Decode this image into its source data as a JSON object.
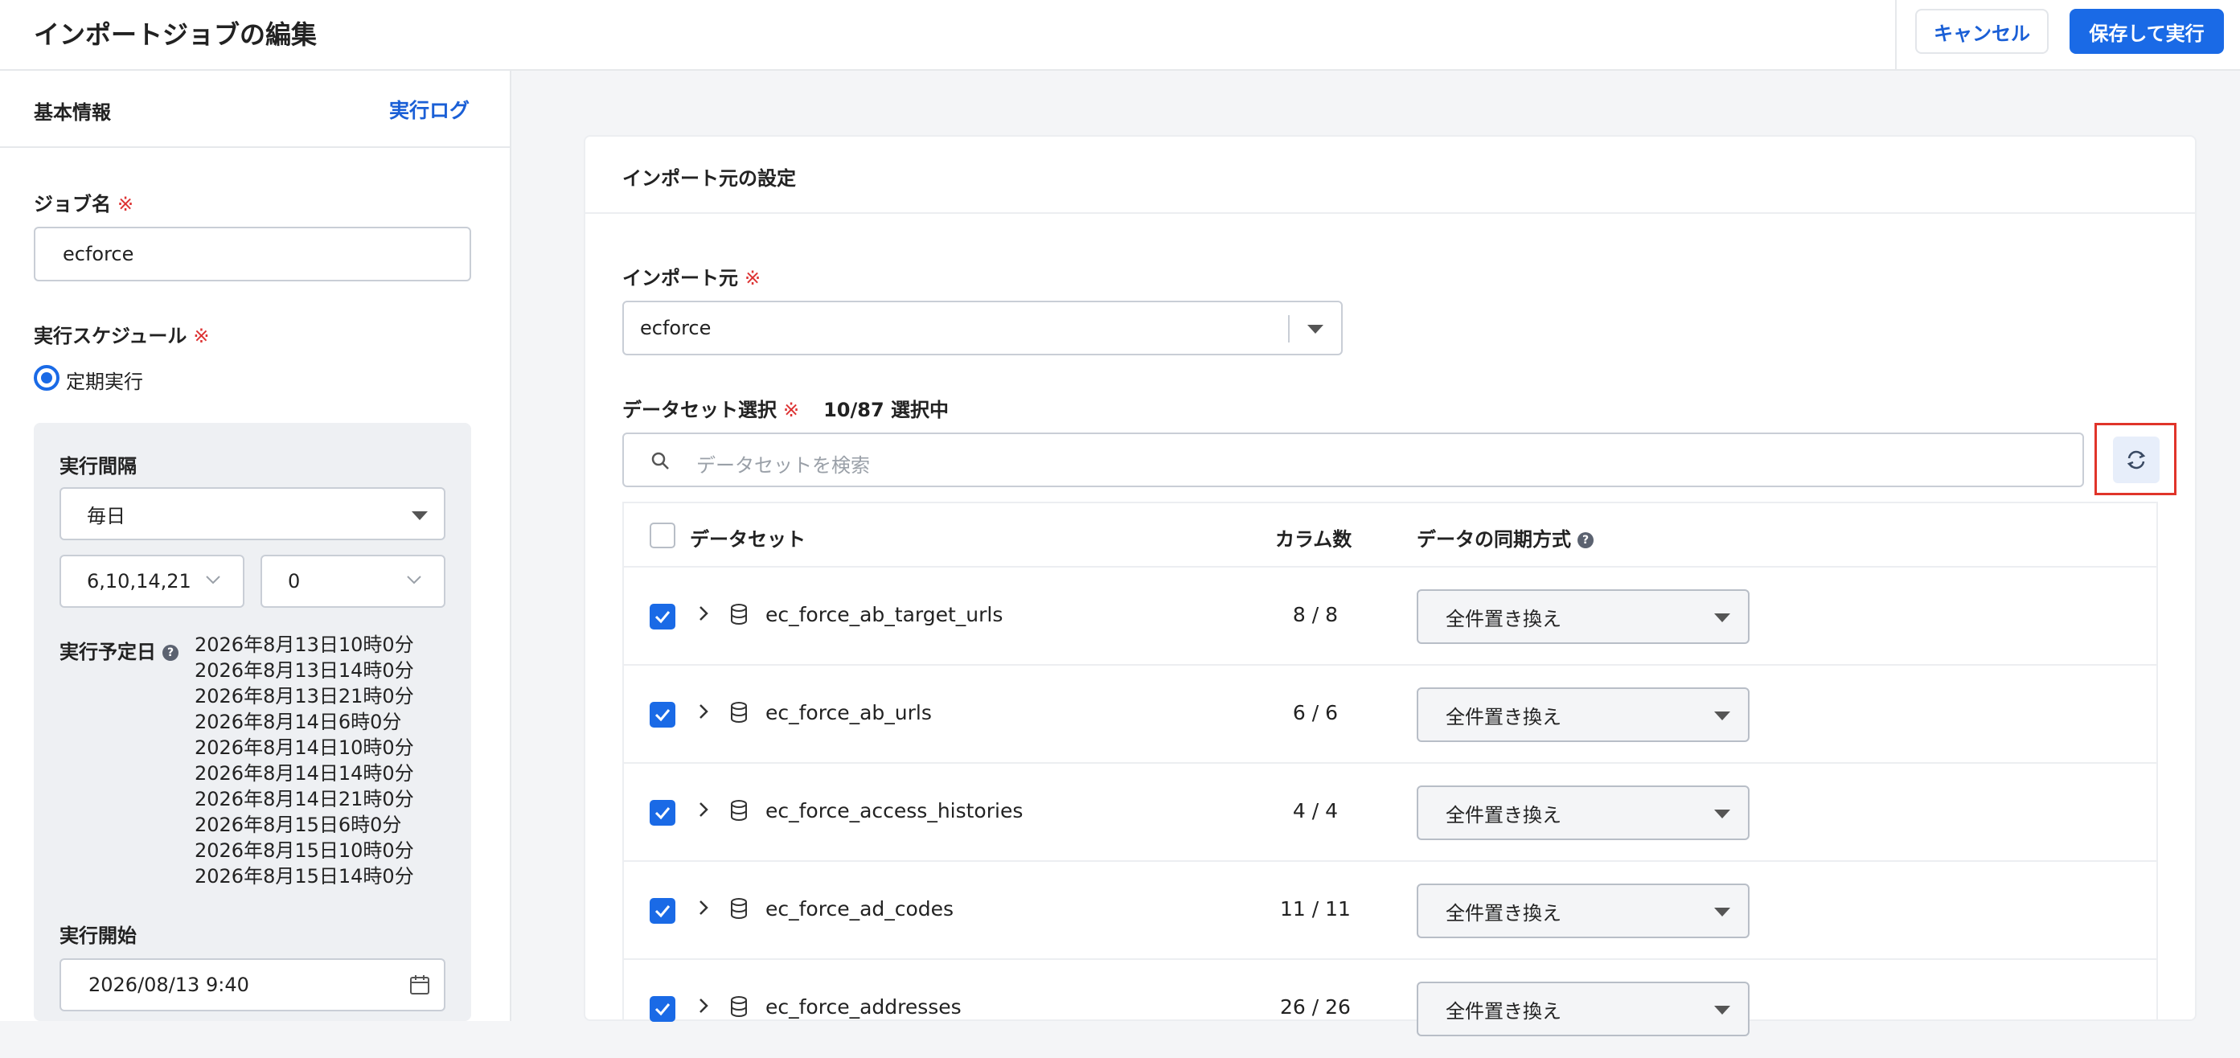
{
  "header": {
    "title": "インポートジョブの編集",
    "cancel_label": "キャンセル",
    "save_label": "保存して実行"
  },
  "sidebar": {
    "title": "基本情報",
    "log_link": "実行ログ",
    "required_mark": "※",
    "job_name_label": "ジョブ名",
    "job_name_value": "ecforce",
    "schedule_label": "実行スケジュール",
    "schedule_option": "定期実行",
    "interval_label": "実行間隔",
    "interval_value": "毎日",
    "hours_value": "6,10,14,21",
    "minutes_value": "0",
    "planned_label": "実行予定日",
    "planned_dates": [
      "2026年8月13日10時0分",
      "2026年8月13日14時0分",
      "2026年8月13日21時0分",
      "2026年8月14日6時0分",
      "2026年8月14日10時0分",
      "2026年8月14日14時0分",
      "2026年8月14日21時0分",
      "2026年8月15日6時0分",
      "2026年8月15日10時0分",
      "2026年8月15日14時0分"
    ],
    "start_label": "実行開始",
    "start_value": "2026/08/13 9:40"
  },
  "main": {
    "card_title": "インポート元の設定",
    "source_label": "インポート元",
    "source_value": "ecforce",
    "dataset_label": "データセット選択",
    "dataset_count": "10/87 選択中",
    "search_placeholder": "データセットを検索",
    "table": {
      "col_dataset": "データセット",
      "col_columns": "カラム数",
      "col_sync": "データの同期方式",
      "rows": [
        {
          "name": "ec_force_ab_target_urls",
          "columns": "8 / 8",
          "sync": "全件置き換え",
          "checked": true
        },
        {
          "name": "ec_force_ab_urls",
          "columns": "6 / 6",
          "sync": "全件置き換え",
          "checked": true
        },
        {
          "name": "ec_force_access_histories",
          "columns": "4 / 4",
          "sync": "全件置き換え",
          "checked": true
        },
        {
          "name": "ec_force_ad_codes",
          "columns": "11 / 11",
          "sync": "全件置き換え",
          "checked": true
        },
        {
          "name": "ec_force_addresses",
          "columns": "26 / 26",
          "sync": "全件置き換え",
          "checked": true
        }
      ]
    }
  },
  "colors": {
    "accent": "#1a6ae6",
    "link": "#1a5fd6",
    "required": "#dd3333",
    "highlight_border": "#e0342a"
  },
  "icons": [
    "search-icon",
    "refresh-icon",
    "calendar-icon",
    "chevron-right-icon",
    "database-icon",
    "help-icon",
    "caret-down-icon",
    "check-icon"
  ]
}
